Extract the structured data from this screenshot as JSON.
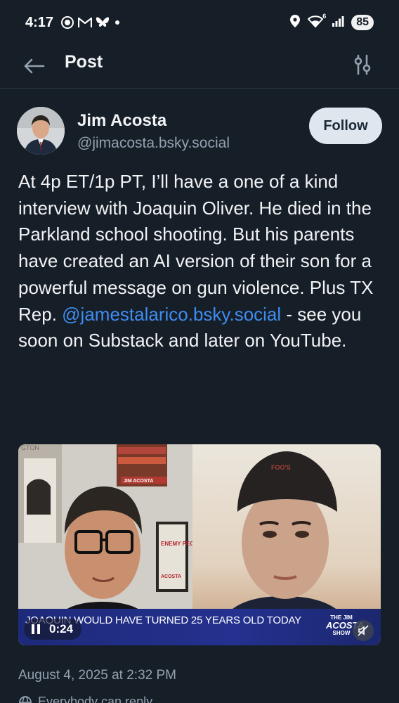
{
  "status_bar": {
    "time": "4:17",
    "left_icons": [
      "chat-bubble-icon",
      "gmail-icon",
      "bluesky-icon"
    ],
    "right_icons": [
      "location-icon",
      "wifi-icon",
      "signal-icon"
    ],
    "wifi_label": "6",
    "battery": "85"
  },
  "header": {
    "title": "Post"
  },
  "post": {
    "author": {
      "name": "Jim Acosta",
      "handle": "@jimacosta.bsky.social"
    },
    "follow_label": "Follow",
    "text_before_mention": "At 4p ET/1p PT, I’ll have a one of a kind interview with Joaquin Oliver. He died in the Parkland school shooting. But his parents have created an AI version of their son for a powerful message on gun violence. Plus TX Rep. ",
    "mention": "@jamestalarico.bsky.social",
    "text_after_mention": " - see you soon on Substack and later on YouTube.",
    "video": {
      "caption": "JOAQUIN WOULD HAVE TURNED 25 YEARS OLD TODAY",
      "elapsed": "0:24",
      "logo_lines": [
        "THE JIM",
        "ACOSTA",
        "SHOW"
      ],
      "backdrop_sign": "GTON",
      "poster_text": "ENEMY PEOPLE",
      "poster_footer": "ACOSTA",
      "book_text": "JIM ACOSTA",
      "beanie_text": "FOO'S"
    },
    "timestamp": "August 4, 2025 at 2:32 PM",
    "reply_setting": "Everybody can reply"
  },
  "colors": {
    "background": "#161e27",
    "accent_link": "#3f8cf1",
    "muted_text": "#93a1b0",
    "follow_bg": "#dfe6ed"
  }
}
